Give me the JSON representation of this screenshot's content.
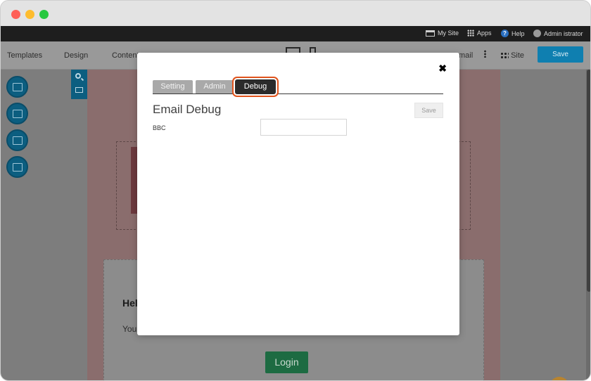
{
  "adminbar": {
    "my_site": "My Site",
    "apps": "Apps",
    "help": "Help",
    "user": "Admin istrator"
  },
  "toolbar": {
    "templates": "Templates",
    "design": "Design",
    "content": "Content",
    "email": "mail",
    "site": "Site",
    "save": "Save"
  },
  "background_page": {
    "heading": "Hel",
    "text": "You",
    "login": "Login"
  },
  "modal": {
    "tabs": [
      {
        "label": "Setting"
      },
      {
        "label": "Admin"
      },
      {
        "label": "Debug"
      }
    ],
    "active_tab": "Debug",
    "title": "Email Debug",
    "save": "Save",
    "fields": [
      {
        "label": "BBC",
        "value": ""
      }
    ]
  },
  "colors": {
    "active_tab_highlight": "#e0531c",
    "primary_save": "#0f7fb0",
    "login_button": "#1d6b42"
  }
}
